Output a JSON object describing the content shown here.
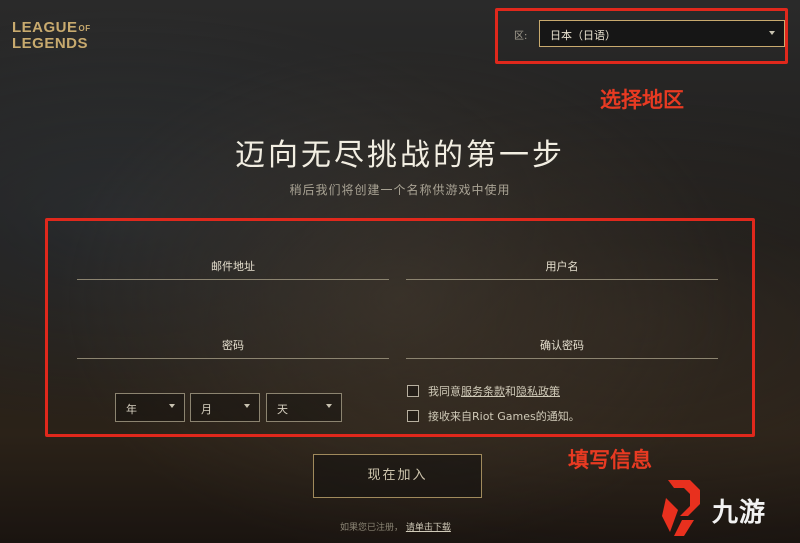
{
  "logo": {
    "line1": "LEAGUE",
    "of": "OF",
    "line2": "LEGENDS"
  },
  "region": {
    "label": "区:",
    "selected": "日本（日语）"
  },
  "annotations": {
    "region": "选择地区",
    "fill_info": "填写信息"
  },
  "headline": "迈向无尽挑战的第一步",
  "subheadline": "稍后我们将创建一个名称供游戏中使用",
  "form": {
    "email_placeholder": "邮件地址",
    "username_placeholder": "用户名",
    "password_placeholder": "密码",
    "confirm_password_placeholder": "确认密码",
    "year": "年",
    "month": "月",
    "day": "天",
    "agree_prefix": "我同意",
    "terms_link": "服务条款",
    "and": "和",
    "privacy_link": "隐私政策",
    "receive_notice": "接收来自Riot Games的通知。"
  },
  "join_button": "现在加入",
  "footer": {
    "prefix": "如果您已注册，",
    "download_link": "请单击下载"
  },
  "watermark": {
    "text": "九游"
  },
  "colors": {
    "gold": "#c8aa6e",
    "annotation_red": "#e0281c",
    "watermark_red": "#e8301e"
  }
}
